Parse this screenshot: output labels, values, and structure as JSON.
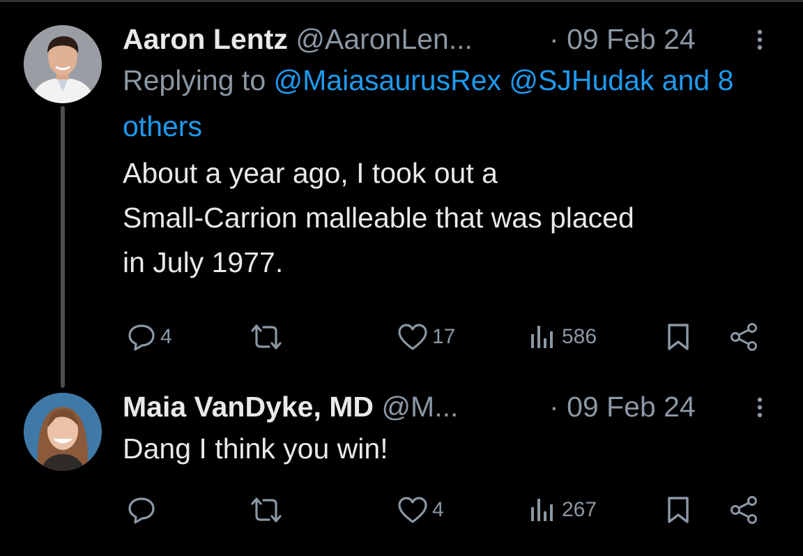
{
  "tweets": [
    {
      "name": "Aaron Lentz",
      "handle": "@AaronLen...",
      "dot": "·",
      "date": "09 Feb 24",
      "replying_prefix": "Replying to",
      "mentions": [
        "@MaiasaurusRex",
        "@SJHudak"
      ],
      "others": "and 8 others",
      "text_lines": [
        "About a year ago, I took out a",
        "Small-Carrion malleable that was placed",
        "in July 1977."
      ],
      "replies": "4",
      "retweets": "",
      "likes": "17",
      "views": "586",
      "icons": [
        "reply-icon",
        "retweet-icon",
        "heart-icon",
        "views-icon",
        "bookmark-icon",
        "share-icon",
        "more-icon"
      ]
    },
    {
      "name": "Maia VanDyke, MD",
      "handle": "@M...",
      "dot": "·",
      "date": "09 Feb 24",
      "text_lines": [
        "Dang I think you win!"
      ],
      "replies": "",
      "retweets": "",
      "likes": "4",
      "views": "267",
      "icons": [
        "reply-icon",
        "retweet-icon",
        "heart-icon",
        "views-icon",
        "bookmark-icon",
        "share-icon",
        "more-icon"
      ]
    }
  ],
  "colors": {
    "background": "#000000",
    "text": "#e7e9ea",
    "muted": "#8b98a5",
    "link": "#1d9bf0"
  }
}
